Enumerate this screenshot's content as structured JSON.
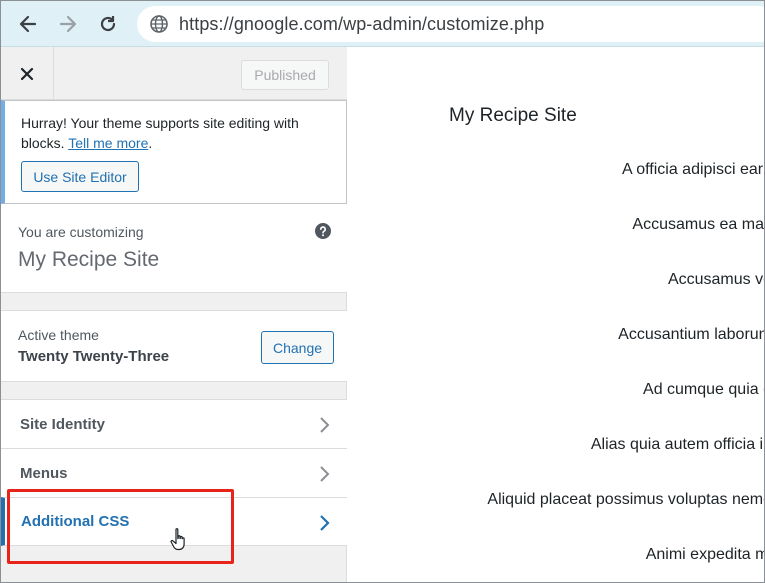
{
  "browser": {
    "url": "https://gnoogle.com/wp-admin/customize.php"
  },
  "sidebar": {
    "published_label": "Published",
    "notice": {
      "text": "Hurray! Your theme supports site editing with blocks.",
      "link": "Tell me more",
      "after_link": ".",
      "button": "Use Site Editor"
    },
    "customizing": {
      "label": "You are customizing",
      "site_name": "My Recipe Site"
    },
    "theme": {
      "label": "Active theme",
      "name": "Twenty Twenty-Three",
      "change_label": "Change"
    },
    "items": [
      {
        "label": "Site Identity"
      },
      {
        "label": "Menus"
      },
      {
        "label": "Additional CSS"
      }
    ]
  },
  "preview": {
    "site_title": "My Recipe Site",
    "posts": [
      "A officia adipisci earu",
      "Accusamus ea max",
      "Accusamus vo",
      "Accusantium laborum",
      "Ad cumque quia e",
      "Alias quia autem officia iu",
      "Aliquid placeat possimus voluptas nemo",
      "Animi expedita mi"
    ]
  },
  "colors": {
    "accent": "#2271b1",
    "highlight": "#e8231a",
    "notice_border": "#72aee6"
  }
}
